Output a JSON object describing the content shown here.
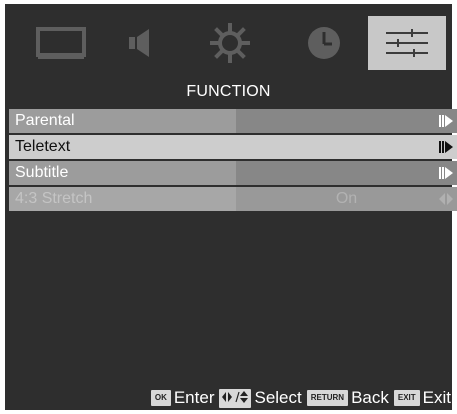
{
  "tabs": [
    {
      "name": "picture-tab",
      "icon": "monitor-icon"
    },
    {
      "name": "sound-tab",
      "icon": "speaker-icon"
    },
    {
      "name": "setup-tab",
      "icon": "gear-icon"
    },
    {
      "name": "time-tab",
      "icon": "clock-icon"
    },
    {
      "name": "function-tab",
      "icon": "sliders-icon"
    }
  ],
  "menu": {
    "title": "FUNCTION",
    "items": [
      {
        "label": "Parental",
        "value": ""
      },
      {
        "label": "Teletext",
        "value": ""
      },
      {
        "label": "Subtitle",
        "value": ""
      },
      {
        "label": "4:3 Stretch",
        "value": "On"
      }
    ]
  },
  "footer": {
    "ok_key": "OK",
    "enter_label": "Enter",
    "select_label": "Select",
    "return_key": "RETURN",
    "back_label": "Back",
    "exit_key": "EXIT",
    "exit_label": "Exit"
  }
}
